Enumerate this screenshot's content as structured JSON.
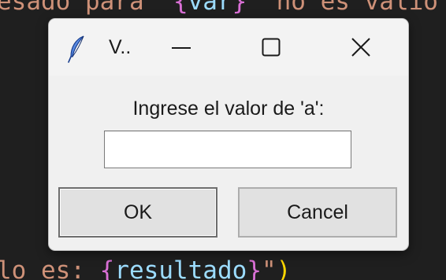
{
  "background_code": {
    "top_line": {
      "pre": "esado para  ",
      "brace_open": "{",
      "var": "var",
      "brace_close": "}",
      "post": "  no es valio"
    },
    "bottom_line": {
      "pre": "lo es: ",
      "brace_open": "{",
      "var": "resultado",
      "brace_close": "}",
      "quote": "\"",
      "paren": ")"
    }
  },
  "dialog": {
    "title": "V..",
    "icon": "feather-icon",
    "prompt": "Ingrese el valor de 'a':",
    "input_value": "",
    "ok_label": "OK",
    "cancel_label": "Cancel"
  },
  "colors": {
    "editor_background": "#1f1f1f",
    "string": "#ce9178",
    "variable": "#9cdcfe",
    "brace": "#da70d6",
    "dialog_background": "#f0f0f0"
  }
}
